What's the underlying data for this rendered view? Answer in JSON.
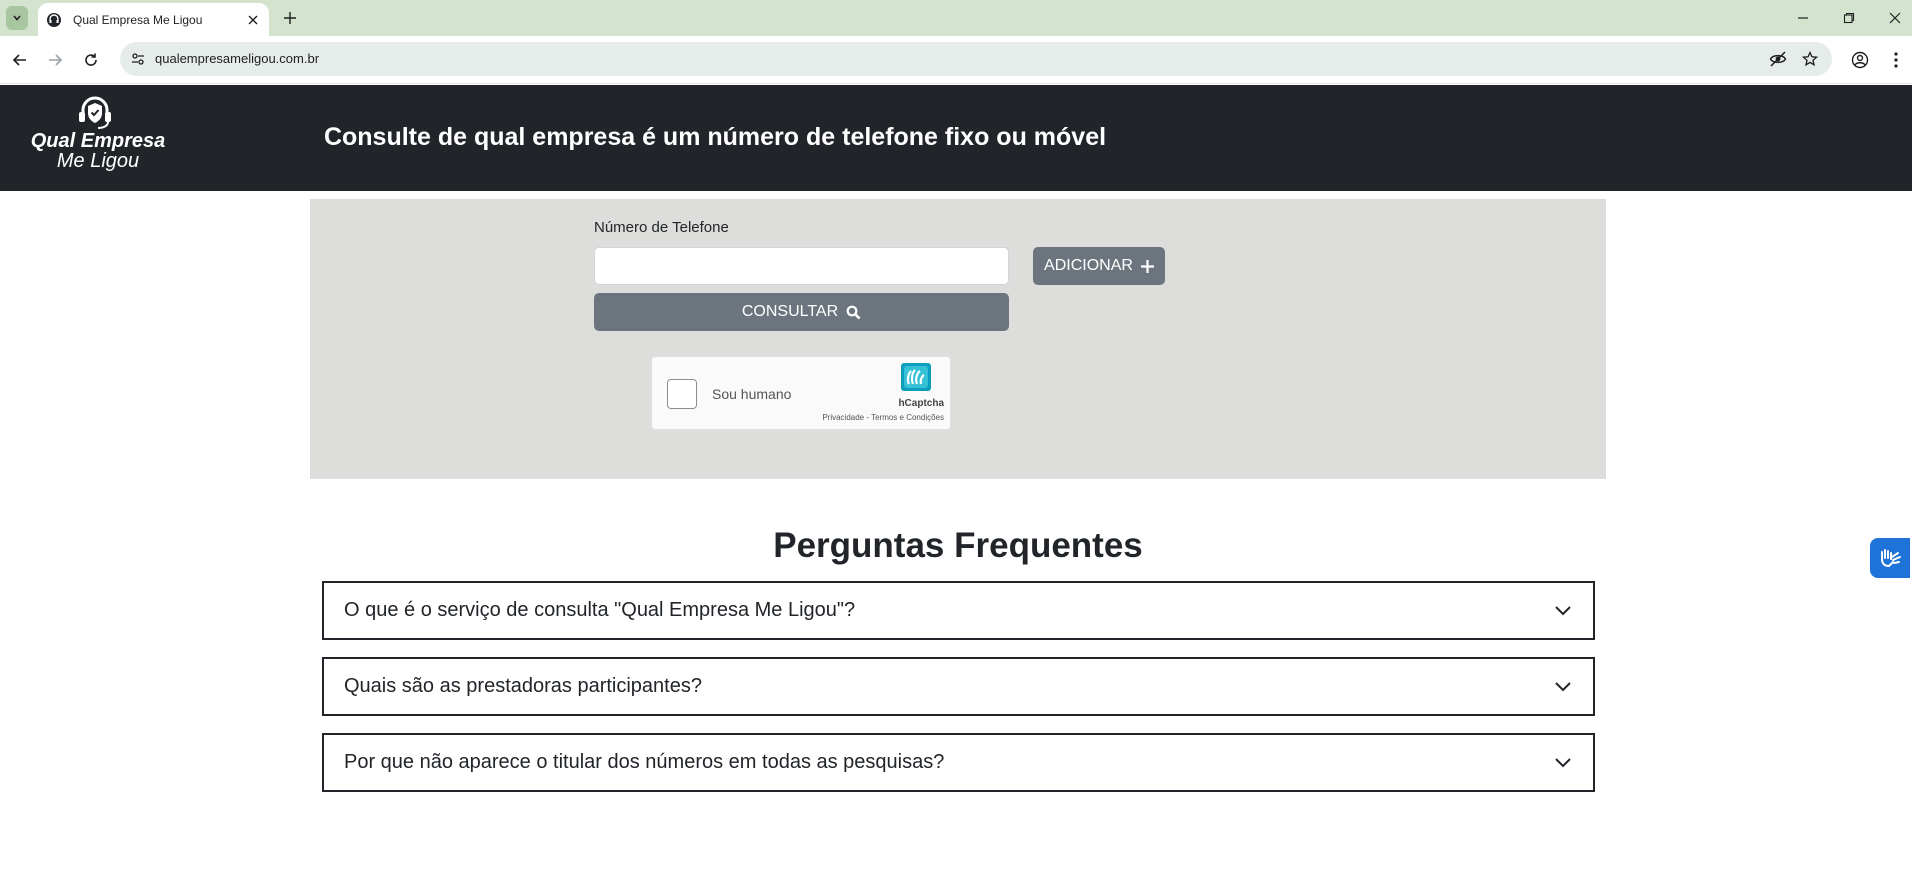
{
  "browser": {
    "tab_title": "Qual Empresa Me Ligou",
    "url": "qualempresameligou.com.br"
  },
  "header": {
    "logo_line1": "Qual Empresa",
    "logo_line2": "Me Ligou",
    "title": "Consulte de qual empresa é um número de telefone fixo ou móvel"
  },
  "form": {
    "phone_label": "Número de Telefone",
    "phone_value": "",
    "add_label": "ADICIONAR",
    "query_label": "CONSULTAR",
    "captcha_label": "Sou humano",
    "captcha_brand": "hCaptcha",
    "captcha_links": "Privacidade - Termos e Condições"
  },
  "faq": {
    "title": "Perguntas Frequentes",
    "items": [
      {
        "question": "O que é o serviço de consulta \"Qual Empresa Me Ligou\"?"
      },
      {
        "question": "Quais são as prestadoras participantes?"
      },
      {
        "question": "Por que não aparece o titular dos números em todas as pesquisas?"
      }
    ]
  },
  "colors": {
    "header_bg": "#212529",
    "panel_bg": "#dddddb",
    "button_bg": "#6c757d",
    "accessibility_bg": "#1e73d8"
  }
}
